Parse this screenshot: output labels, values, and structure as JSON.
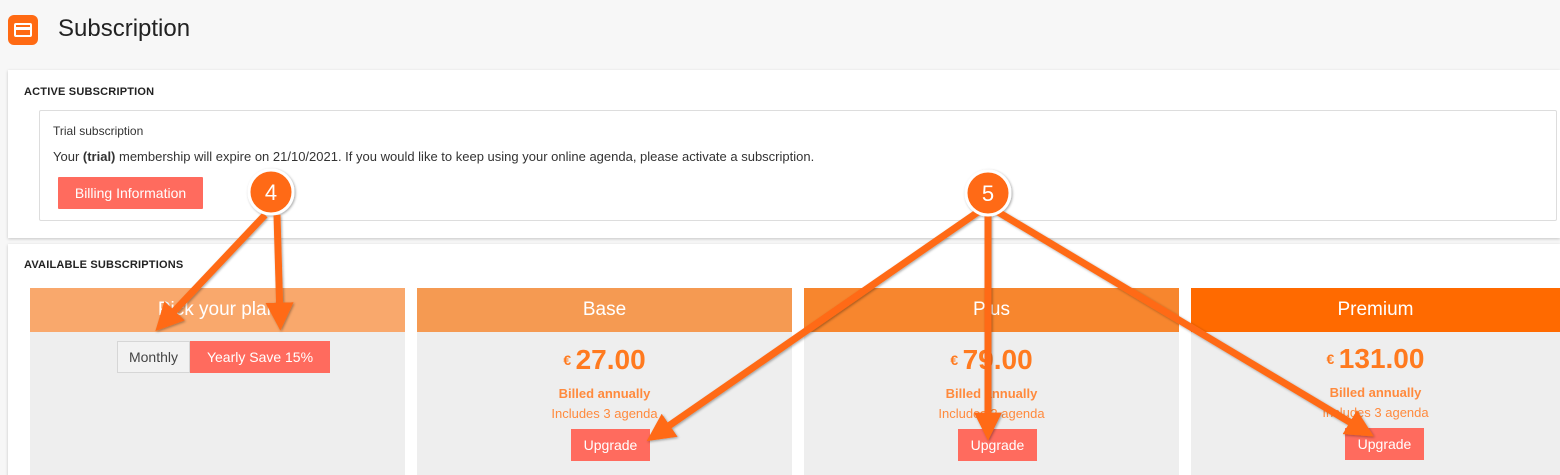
{
  "header": {
    "title": "Subscription",
    "icon": "credit-card-icon"
  },
  "active": {
    "section_label": "ACTIVE SUBSCRIPTION",
    "trial_title": "Trial subscription",
    "message_prefix": "Your ",
    "message_bold": "(trial)",
    "message_suffix": " membership will expire on 21/10/2021. If you would like to keep using your online agenda, please activate a subscription.",
    "billing_button": "Billing Information"
  },
  "available": {
    "section_label": "AVAILABLE SUBSCRIPTIONS",
    "picker": {
      "title": "Pick your plan",
      "monthly": "Monthly",
      "yearly": "Yearly Save 15%",
      "selected": "Yearly Save 15%"
    },
    "plans": [
      {
        "name": "Base",
        "currency": "€",
        "price": "27.00",
        "billed": "Billed annually",
        "includes": "Includes 3 agenda",
        "button": "Upgrade"
      },
      {
        "name": "Plus",
        "currency": "€",
        "price": "79.00",
        "billed": "Billed annually",
        "includes": "Includes 3 agenda",
        "button": "Upgrade"
      },
      {
        "name": "Premium",
        "currency": "€",
        "price": "131.00",
        "billed": "Billed annually",
        "includes": "Includes 3 agenda",
        "button": "Upgrade"
      }
    ]
  },
  "annotations": {
    "badge_4": "4",
    "badge_5": "5"
  },
  "colors": {
    "accent": "#ff6a13",
    "button": "#ff6b5e",
    "picker_header": "#f9a86c",
    "base_header": "#f59a52",
    "plus_header": "#f7862e",
    "premium_header": "#ff6a00",
    "price": "#ff7a1f"
  }
}
